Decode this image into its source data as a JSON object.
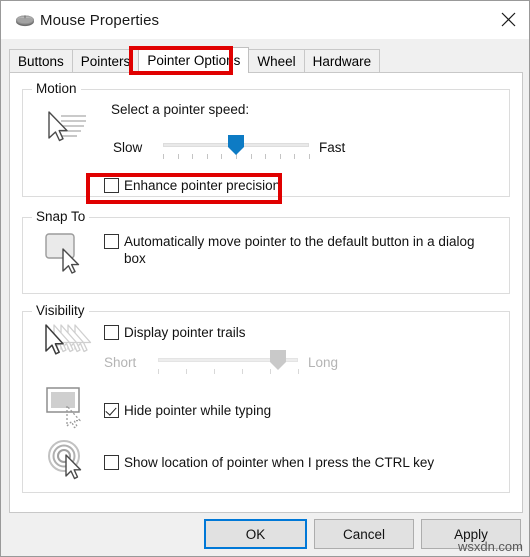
{
  "window": {
    "title": "Mouse Properties",
    "icon": "mouse-icon",
    "close_icon": "close-icon"
  },
  "tabs": [
    {
      "label": "Buttons",
      "selected": false
    },
    {
      "label": "Pointers",
      "selected": false
    },
    {
      "label": "Pointer Options",
      "selected": true
    },
    {
      "label": "Wheel",
      "selected": false
    },
    {
      "label": "Hardware",
      "selected": false
    }
  ],
  "groups": {
    "motion": {
      "label": "Motion",
      "icon": "pointer-speed-icon",
      "speed_prompt": "Select a pointer speed:",
      "slider": {
        "min_label": "Slow",
        "max_label": "Fast",
        "value_percent": 50,
        "tick_count": 11,
        "enabled": true
      },
      "enhance_precision": {
        "label": "Enhance pointer precision",
        "checked": false
      }
    },
    "snap_to": {
      "label": "Snap To",
      "icon": "snap-to-button-icon",
      "auto_move": {
        "label": "Automatically move pointer to the default button in a dialog box",
        "checked": false
      }
    },
    "visibility": {
      "label": "Visibility",
      "trails": {
        "icon": "pointer-trails-icon",
        "label": "Display pointer trails",
        "checked": false,
        "slider": {
          "min_label": "Short",
          "max_label": "Long",
          "value_percent": 86,
          "tick_count": 6,
          "enabled": false
        }
      },
      "hide_while_typing": {
        "icon": "hide-pointer-icon",
        "label": "Hide pointer while typing",
        "checked": true
      },
      "show_location": {
        "icon": "locate-pointer-icon",
        "label": "Show location of pointer when I press the CTRL key",
        "checked": false
      }
    }
  },
  "footer": {
    "ok": "OK",
    "cancel": "Cancel",
    "apply": "Apply"
  },
  "annotations": {
    "tab_highlight_color": "#e00000",
    "checkbox_highlight_color": "#e00000"
  },
  "watermark": "wsxdn.com"
}
